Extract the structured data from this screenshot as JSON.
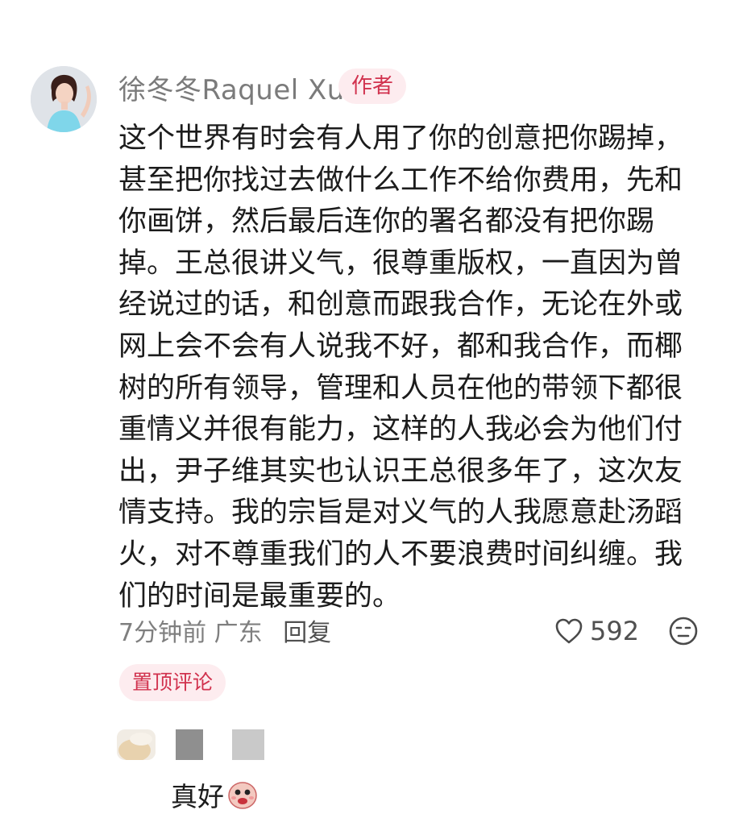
{
  "comment": {
    "username": "徐冬冬Raquel Xu",
    "author_badge": "作者",
    "text": "这个世界有时会有人用了你的创意把你踢掉，甚至把你找过去做什么工作不给你费用，先和你画饼，然后最后连你的署名都没有把你踢掉。王总很讲义气，很尊重版权，一直因为曾经说过的话，和创意而跟我合作，无论在外或网上会不会有人说我不好，都和我合作，而椰树的所有领导，管理和人员在他的带领下都很重情义并很有能力，这样的人我必会为他们付出，尹子维其实也认识王总很多年了，这次友情支持。我的宗旨是对义气的人我愿意赴汤蹈火，对不尊重我们的人不要浪费时间纠缠。我们的时间是最重要的。",
    "time": "7分钟前",
    "location": "广东",
    "reply_label": "回复",
    "likes": "592",
    "pinned_label": "置顶评论"
  },
  "reply": {
    "text": "真好"
  },
  "icons": {
    "like": "heart-outline-icon",
    "emoji": "emoji-face-icon",
    "sticker": "sticker-face-icon"
  },
  "colors": {
    "badge_bg": "#fdecef",
    "badge_text": "#d1324e",
    "muted_text": "#7f7f7f"
  }
}
